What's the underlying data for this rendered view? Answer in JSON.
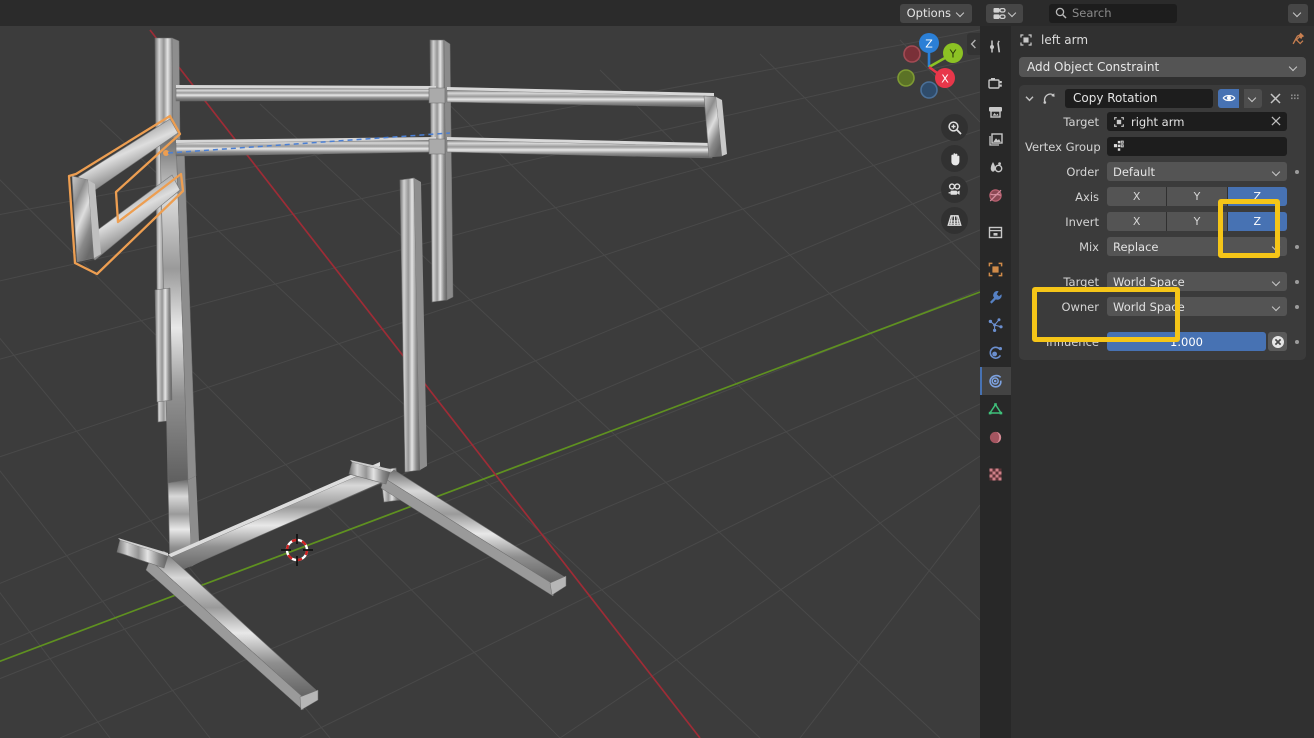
{
  "viewport": {
    "options_button": "Options",
    "gizmo_axes": [
      {
        "label": "Z",
        "color": "#2b7fd6",
        "filled": true
      },
      {
        "label": "Y",
        "color": "#8cc224",
        "filled": true
      },
      {
        "label": "X",
        "color": "#e8374a",
        "filled": true
      },
      {
        "label": "",
        "color": "#7a3038",
        "filled": false
      },
      {
        "label": "",
        "color": "#5b7226",
        "filled": false
      },
      {
        "label": "",
        "color": "#2f4c6b",
        "filled": false
      }
    ],
    "tool_buttons": [
      {
        "name": "zoom-icon"
      },
      {
        "name": "hand-icon"
      },
      {
        "name": "camera-icon"
      },
      {
        "name": "grid-icon"
      }
    ],
    "selected_object_outline_color": "#ED9E51",
    "relationship_line_color": "#4a7fd4",
    "axis_x_color": "#9c2b35",
    "axis_y_color": "#5b8c1e",
    "background_color": "#3c3c3c"
  },
  "properties": {
    "header": {
      "editor_type_icon": "properties-editor-icon",
      "search_placeholder": "Search",
      "menu_icon": "chevron-down-icon"
    },
    "tabs": [
      {
        "name": "tool",
        "icon": "tool-icon",
        "active": false
      },
      {
        "name": "render",
        "icon": "camera-back-icon",
        "active": false
      },
      {
        "name": "output",
        "icon": "printer-icon",
        "active": false
      },
      {
        "name": "view-layer",
        "icon": "images-icon",
        "active": false
      },
      {
        "name": "scene",
        "icon": "scene-cone-icon",
        "active": false
      },
      {
        "name": "world",
        "icon": "world-globe-icon",
        "active": false
      },
      {
        "name": "collection",
        "icon": "collection-box-icon",
        "active": false
      },
      {
        "name": "object",
        "icon": "object-square-icon",
        "active": false
      },
      {
        "name": "modifiers",
        "icon": "wrench-icon",
        "active": false
      },
      {
        "name": "particles",
        "icon": "particles-icon",
        "active": false
      },
      {
        "name": "physics",
        "icon": "physics-orbit-icon",
        "active": false
      },
      {
        "name": "object-constraints",
        "icon": "constraint-icon",
        "active": true
      },
      {
        "name": "object-data",
        "icon": "mesh-data-triangle-icon",
        "active": false
      },
      {
        "name": "material",
        "icon": "material-sphere-icon",
        "active": false
      },
      {
        "name": "texture",
        "icon": "texture-checker-icon",
        "active": false
      }
    ],
    "breadcrumb": {
      "object_icon": "object-square-icon",
      "object_name": "left arm",
      "pin_icon": "pin-icon"
    },
    "add_constraint_label": "Add Object Constraint",
    "constraint": {
      "expand_icon": "chevron-down-icon",
      "type_icon": "copy-rotation-icon",
      "name": "Copy Rotation",
      "eye_icon": "eye-icon",
      "eye_enabled": true,
      "extras_icon": "chevron-down-icon",
      "close_icon": "close-icon",
      "grip_icon": "drag-grip-icon",
      "rows": {
        "target_label": "Target",
        "target_icon": "object-square-icon",
        "target_value": "right arm",
        "target_clear_icon": "close-icon",
        "vertex_group_label": "Vertex Group",
        "vertex_group_icon": "vertex-group-icon",
        "vertex_group_value": "",
        "order_label": "Order",
        "order_value": "Default",
        "axis_label": "Axis",
        "axis_toggles": [
          {
            "label": "X",
            "on": false
          },
          {
            "label": "Y",
            "on": false
          },
          {
            "label": "Z",
            "on": true
          }
        ],
        "invert_label": "Invert",
        "invert_toggles": [
          {
            "label": "X",
            "on": false
          },
          {
            "label": "Y",
            "on": false
          },
          {
            "label": "Z",
            "on": true
          }
        ],
        "mix_label": "Mix",
        "mix_value": "Replace",
        "space_target_label": "Target",
        "space_target_value": "World Space",
        "space_owner_label": "Owner",
        "space_owner_value": "World Space",
        "influence_label": "Influence",
        "influence_value": "1.000",
        "influence_clear_icon": "animate-clear-icon"
      }
    }
  },
  "annotations": {
    "highlight_color": "#F5C518",
    "boxes": [
      {
        "name": "axis-invert-z-highlight"
      },
      {
        "name": "target-owner-space-highlight"
      }
    ]
  }
}
